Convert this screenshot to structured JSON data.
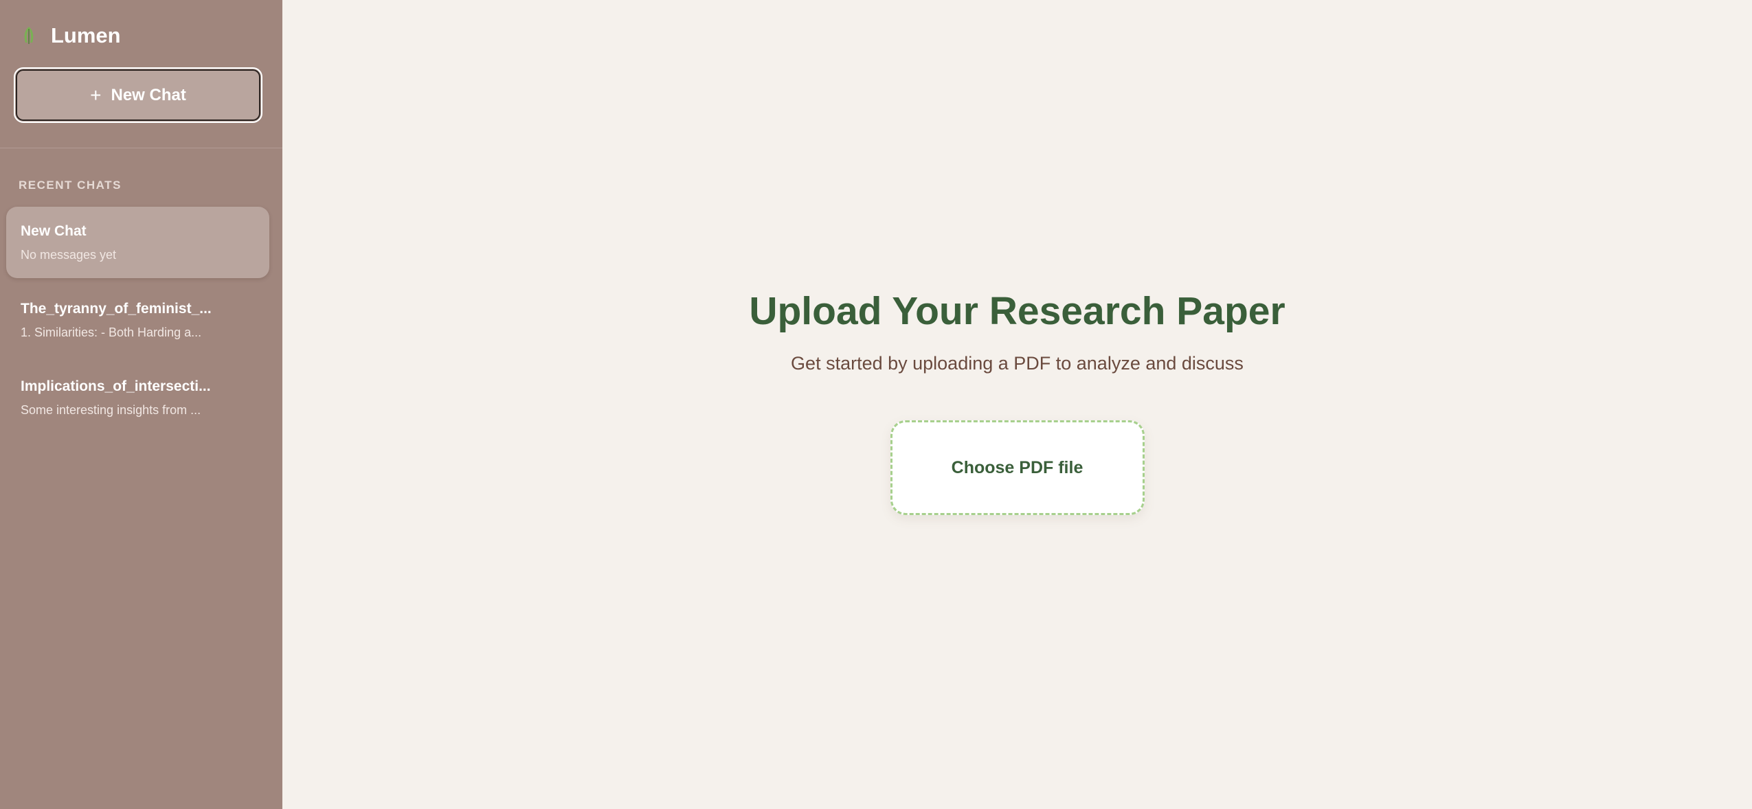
{
  "app": {
    "name": "Lumen"
  },
  "sidebar": {
    "new_chat_icon": "+",
    "new_chat_label": "New Chat",
    "section_label": "RECENT CHATS",
    "chats": [
      {
        "title": "New Chat",
        "preview": "No messages yet",
        "active": true
      },
      {
        "title": "The_tyranny_of_feminist_...",
        "preview": "1. Similarities: - Both Harding a...",
        "active": false
      },
      {
        "title": "Implications_of_intersecti...",
        "preview": "Some interesting insights from ...",
        "active": false
      }
    ]
  },
  "main": {
    "title": "Upload Your Research Paper",
    "subtitle": "Get started by uploading a PDF to analyze and discuss",
    "upload_label": "Choose PDF file"
  },
  "icons": {
    "logo": "leaf-icon",
    "new_chat": "plus-icon"
  },
  "colors": {
    "sidebar_bg": "#a0867d",
    "main_bg": "#f5f1ec",
    "accent_green": "#3a5f3a",
    "upload_border": "#a7d08d"
  }
}
